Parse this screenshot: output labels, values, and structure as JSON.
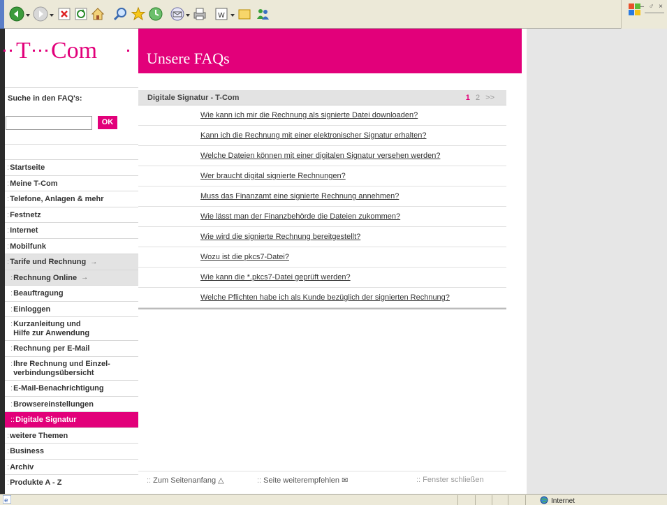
{
  "browser": {
    "toolbar_icons": [
      "back-icon",
      "forward-icon",
      "stop-icon",
      "refresh-icon",
      "home-icon",
      "search-icon",
      "favorites-icon",
      "history-icon",
      "mail-icon",
      "print-icon",
      "word-icon",
      "folder-icon",
      "messenger-icon"
    ]
  },
  "header": {
    "logo_text": "T··Com",
    "title": "Unsere FAQs"
  },
  "search": {
    "label": "Suche in den FAQ's:",
    "input_value": "",
    "ok_label": "OK"
  },
  "nav": {
    "items": [
      {
        "label": "Startseite"
      },
      {
        "label": "Meine T-Com"
      },
      {
        "label": "Telefone, Anlagen & mehr"
      },
      {
        "label": "Festnetz"
      },
      {
        "label": "Internet"
      },
      {
        "label": "Mobilfunk"
      },
      {
        "label": "Tarife und Rechnung"
      },
      {
        "label": "Rechnung Online"
      },
      {
        "label": "Beauftragung"
      },
      {
        "label": "Einloggen"
      },
      {
        "label": "Kurzanleitung und",
        "label2": "Hilfe zur Anwendung"
      },
      {
        "label": "Rechnung per E-Mail"
      },
      {
        "label": "Ihre Rechnung und Einzel-",
        "label2": "verbindungsübersicht"
      },
      {
        "label": "E-Mail-Benachrichtigung"
      },
      {
        "label": "Browsereinstellungen"
      },
      {
        "label": "Digitale Signatur"
      },
      {
        "label": "weitere Themen"
      },
      {
        "label": "Business"
      },
      {
        "label": "Archiv"
      },
      {
        "label": "Produkte A - Z"
      }
    ]
  },
  "faq": {
    "header_title": "Digitale Signatur - T-Com",
    "pager": {
      "current": "1",
      "next": "2",
      "more": ">>"
    },
    "questions": [
      "Wie kann ich mir die Rechnung als signierte Datei downloaden?",
      "Kann ich die Rechnung mit einer elektronischer Signatur erhalten?",
      "Welche Dateien können mit einer digitalen Signatur versehen werden?",
      "Wer braucht digital signierte Rechnungen?",
      "Muss das Finanzamt eine signierte Rechnung annehmen?",
      "Wie lässt man der Finanzbehörde die Dateien zukommen?",
      "Wie wird die signierte Rechnung bereitgestellt?",
      "Wozu ist die pkcs7-Datei?",
      "Wie kann die *.pkcs7-Datei geprüft werden?",
      "Welche Pflichten habe ich als Kunde bezüglich der signierten Rechnung?"
    ]
  },
  "footer": {
    "top_link": "Zum Seitenanfang",
    "recommend_link": "Seite weiterempfehlen",
    "close_link": "Fenster schließen"
  },
  "statusbar": {
    "zone": "Internet"
  },
  "colors": {
    "brand": "#e2007a",
    "nav_grey": "#e3e3e3"
  }
}
